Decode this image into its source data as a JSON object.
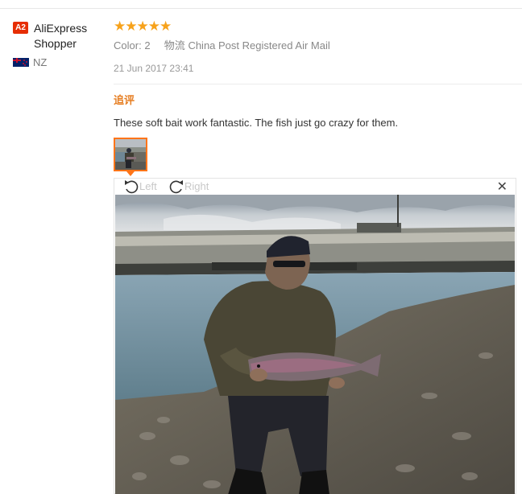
{
  "reviewer": {
    "badge": "A2",
    "name": "AliExpress Shopper",
    "country_code": "NZ",
    "flag_icon": "new-zealand-flag-icon"
  },
  "review": {
    "rating": 5,
    "stars": "★★★★★",
    "color_label": "Color:",
    "color_value": "2",
    "shipping_label": "物流",
    "shipping_value": "China Post Registered Air Mail",
    "date": "21 Jun 2017 23:41",
    "followup_label": "追评",
    "text": "These soft bait work fantastic. The fish just go crazy for them."
  },
  "viewer": {
    "rotate_left_label": "Left",
    "rotate_right_label": "Right",
    "close_symbol": "✕"
  },
  "colors": {
    "star": "#f7a21b",
    "badge": "#e62e04",
    "followup": "#e67e22",
    "thumb_border": "#ff7519"
  }
}
